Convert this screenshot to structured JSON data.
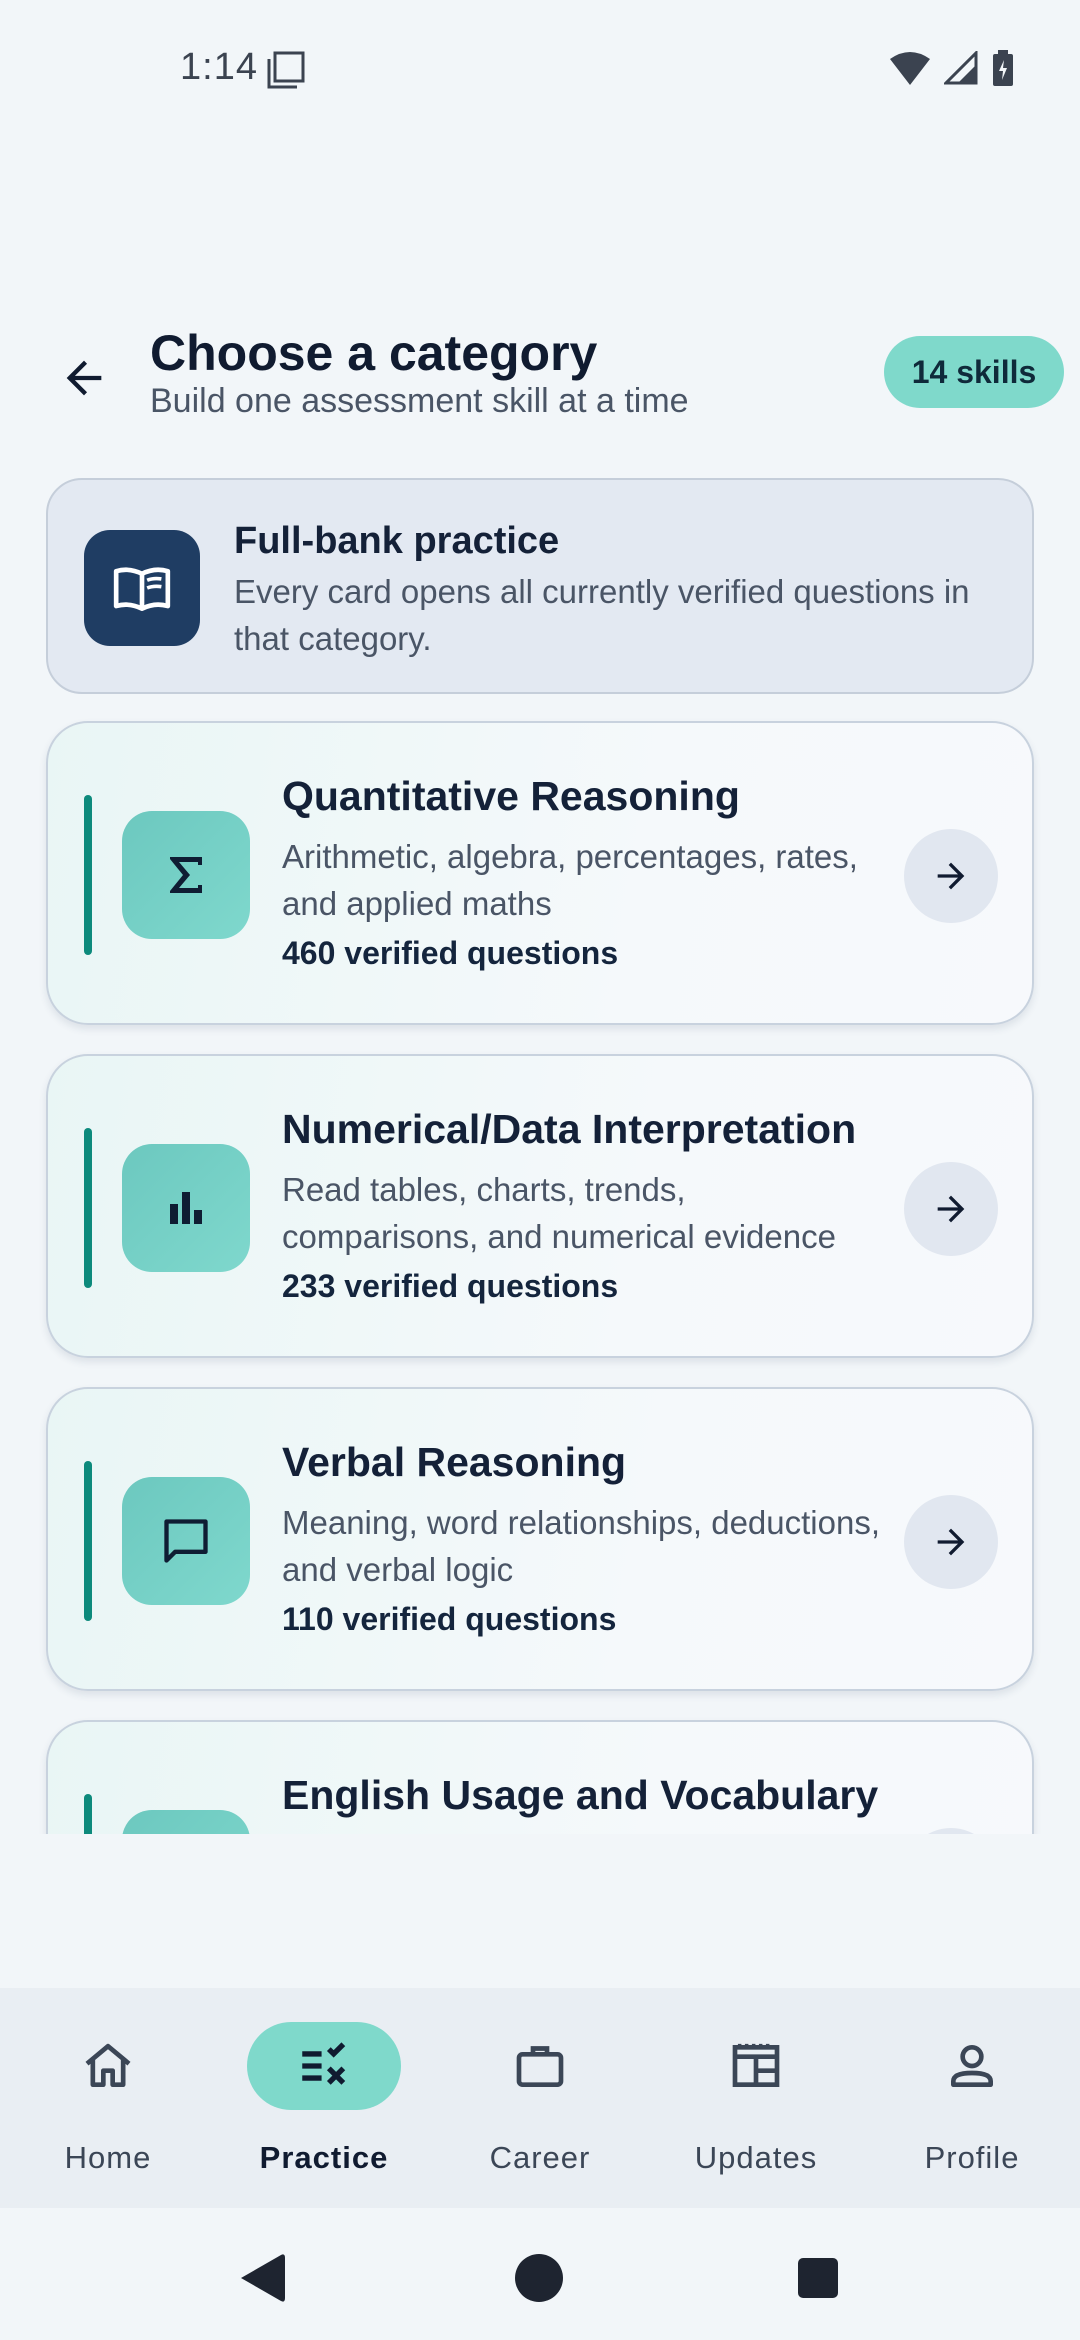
{
  "status": {
    "time": "1:14"
  },
  "header": {
    "title": "Choose a category",
    "subtitle": "Build one assessment skill at a time",
    "badge": "14 skills"
  },
  "info_card": {
    "title": "Full-bank practice",
    "description": "Every card opens all currently verified questions in that category."
  },
  "categories": [
    {
      "title": "Quantitative Reasoning",
      "description": "Arithmetic, algebra, percentages, rates, and applied maths",
      "count": "460 verified questions",
      "icon": "sigma-icon"
    },
    {
      "title": "Numerical/Data Interpretation",
      "description": "Read tables, charts, trends, comparisons, and numerical evidence",
      "count": "233 verified questions",
      "icon": "bar-chart-icon"
    },
    {
      "title": "Verbal Reasoning",
      "description": "Meaning, word relationships, deductions, and verbal logic",
      "count": "110 verified questions",
      "icon": "chat-bubble-icon"
    },
    {
      "title": "English Usage and Vocabulary",
      "description": "",
      "count": "",
      "icon": "book-icon"
    }
  ],
  "nav": {
    "items": [
      {
        "label": "Home",
        "icon": "home-icon",
        "active": false
      },
      {
        "label": "Practice",
        "icon": "practice-icon",
        "active": true
      },
      {
        "label": "Career",
        "icon": "briefcase-icon",
        "active": false
      },
      {
        "label": "Updates",
        "icon": "newspaper-icon",
        "active": false
      },
      {
        "label": "Profile",
        "icon": "person-icon",
        "active": false
      }
    ]
  },
  "colors": {
    "accent": "#7fd9cb",
    "accent_dark": "#0d8a7c",
    "navy": "#1f3d63",
    "background": "#f2f6f9"
  }
}
